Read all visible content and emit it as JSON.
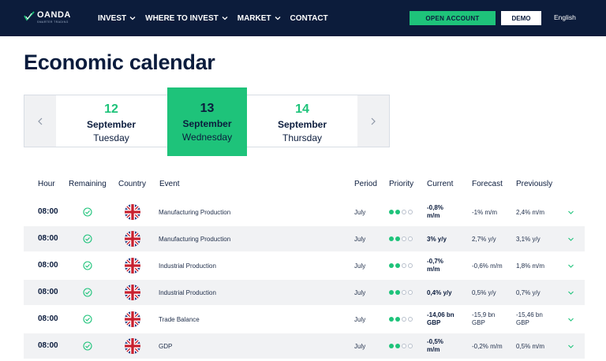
{
  "header": {
    "logo": {
      "name": "OANDA",
      "tagline": "SMARTER TRADING"
    },
    "nav": [
      {
        "label": "INVEST",
        "has_menu": true
      },
      {
        "label": "WHERE TO INVEST",
        "has_menu": true
      },
      {
        "label": "MARKET",
        "has_menu": true
      },
      {
        "label": "CONTACT",
        "has_menu": false
      }
    ],
    "open_account": "OPEN ACCOUNT",
    "demo": "DEMO",
    "language": "English"
  },
  "page": {
    "title": "Economic calendar"
  },
  "date_picker": {
    "days": [
      {
        "day": "12",
        "month": "September",
        "weekday": "Tuesday",
        "active": false
      },
      {
        "day": "13",
        "month": "September",
        "weekday": "Wednesday",
        "active": true
      },
      {
        "day": "14",
        "month": "September",
        "weekday": "Thursday",
        "active": false
      }
    ]
  },
  "table": {
    "columns": {
      "hour": "Hour",
      "remaining": "Remaining",
      "country": "Country",
      "event": "Event",
      "period": "Period",
      "priority": "Priority",
      "current": "Current",
      "forecast": "Forecast",
      "previously": "Previously"
    },
    "rows": [
      {
        "hour": "08:00",
        "event": "Manufacturing Production",
        "period": "July",
        "priority": 2,
        "current": [
          "-0,8%",
          "m/m"
        ],
        "forecast": [
          "-1% m/m",
          ""
        ],
        "previously": [
          "2,4% m/m",
          ""
        ]
      },
      {
        "hour": "08:00",
        "event": "Manufacturing Production",
        "period": "July",
        "priority": 2,
        "current": [
          "3% y/y",
          ""
        ],
        "forecast": [
          "2,7% y/y",
          ""
        ],
        "previously": [
          "3,1% y/y",
          ""
        ]
      },
      {
        "hour": "08:00",
        "event": "Industrial Production",
        "period": "July",
        "priority": 2,
        "current": [
          "-0,7%",
          "m/m"
        ],
        "forecast": [
          "-0,6% m/m",
          ""
        ],
        "previously": [
          "1,8% m/m",
          ""
        ]
      },
      {
        "hour": "08:00",
        "event": "Industrial Production",
        "period": "July",
        "priority": 2,
        "current": [
          "0,4% y/y",
          ""
        ],
        "forecast": [
          "0,5% y/y",
          ""
        ],
        "previously": [
          "0,7% y/y",
          ""
        ]
      },
      {
        "hour": "08:00",
        "event": "Trade Balance",
        "period": "July",
        "priority": 2,
        "current": [
          "-14,06 bn",
          "GBP"
        ],
        "forecast": [
          "-15,9 bn",
          "GBP"
        ],
        "previously": [
          "-15,46 bn",
          "GBP"
        ]
      },
      {
        "hour": "08:00",
        "event": "GDP",
        "period": "July",
        "priority": 2,
        "current": [
          "-0,5%",
          "m/m"
        ],
        "forecast": [
          "-0,2% m/m",
          ""
        ],
        "previously": [
          "0,5% m/m",
          ""
        ]
      }
    ]
  },
  "colors": {
    "navy": "#0c1c3b",
    "accent": "#1ec37a",
    "row_alt": "#f1f2f4"
  },
  "icons": [
    "oanda-logo-icon",
    "chevron-down-icon",
    "chevron-left-icon",
    "chevron-right-icon",
    "check-circle-icon",
    "uk-flag-icon"
  ]
}
